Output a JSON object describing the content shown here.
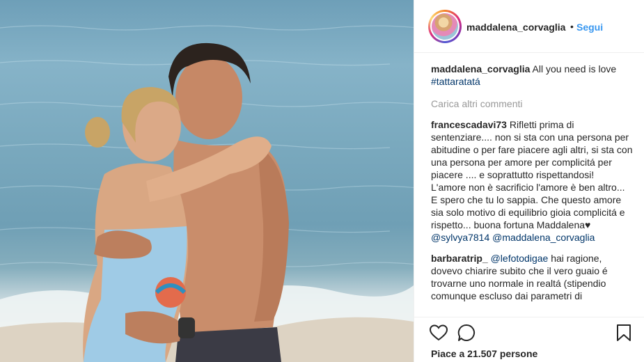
{
  "post": {
    "username": "maddalena_corvaglia",
    "separator": "•",
    "follow_label": "Segui"
  },
  "caption": {
    "username": "maddalena_corvaglia",
    "text": "All you need is love",
    "hashtag": "#tattaratatá"
  },
  "load_more_label": "Carica altri commenti",
  "comments": [
    {
      "username": "francescadavi73",
      "text": "Rifletti prima di sentenziare.... non si sta con una persona per abitudine o per fare piacere agli altri, si sta con una persona per amore per complicitá per piacere .... e soprattutto rispettandosi!\nL'amore non è sacrificio l'amore è ben altro...\nE spero che tu lo sappia. Che questo amore sia solo motivo di equilibrio gioia complicitá e rispetto... buona fortuna Maddalena♥",
      "mention1": "@sylvya7814",
      "mention2": "@maddalena_corvaglia"
    },
    {
      "username": "barbaratrip_",
      "mention": "@lefotodigae",
      "text": "hai ragione, dovevo chiarire subito che il vero guaio é trovarne uno normale in realtá (stipendio comunque escluso dai parametri di"
    }
  ],
  "likes_label": "Piace a 21.507 persone",
  "icons": {
    "like": "heart-icon",
    "comment": "comment-icon",
    "save": "bookmark-icon"
  }
}
